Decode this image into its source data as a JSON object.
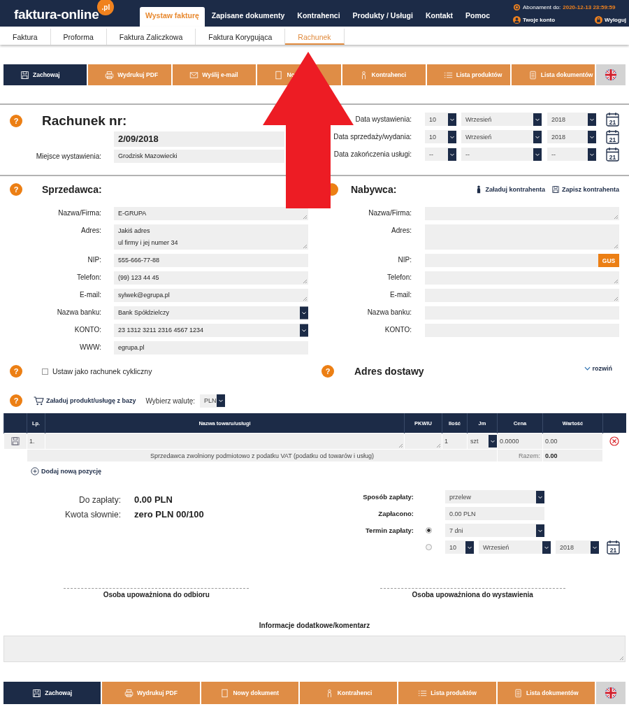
{
  "header": {
    "logo": "faktura-online",
    "logo_badge": ".pl",
    "nav": [
      {
        "label": "Wystaw fakturę",
        "selected": true
      },
      {
        "label": "Zapisane dokumenty",
        "selected": false
      },
      {
        "label": "Kontrahenci",
        "selected": false
      },
      {
        "label": "Produkty / Usługi",
        "selected": false
      },
      {
        "label": "Kontakt",
        "selected": false
      },
      {
        "label": "Pomoc",
        "selected": false
      }
    ],
    "subscription_label": "Abonament do:",
    "subscription_date": "2020-12-13 23:59:59",
    "account": "Twoje konto",
    "logout": "Wyloguj"
  },
  "doc_tabs": [
    {
      "label": "Faktura",
      "selected": false
    },
    {
      "label": "Proforma",
      "selected": false
    },
    {
      "label": "Faktura Zaliczkowa",
      "selected": false
    },
    {
      "label": "Faktura Korygująca",
      "selected": false
    },
    {
      "label": "Rachunek",
      "selected": true
    }
  ],
  "toolbar_top": [
    {
      "kind": "save",
      "label": "Zachowaj"
    },
    {
      "kind": "print",
      "label": "Wydrukuj PDF"
    },
    {
      "kind": "mail",
      "label": "Wyślij e-mail"
    },
    {
      "kind": "new",
      "label": "No"
    },
    {
      "kind": "contacts",
      "label": "Kontrahenci"
    },
    {
      "kind": "products",
      "label": "Lista produktów"
    },
    {
      "kind": "documents",
      "label": "Lista dokumentów"
    },
    {
      "kind": "language"
    }
  ],
  "invoice": {
    "help": "?",
    "title": "Rachunek nr:",
    "number": "2/09/2018",
    "place_label": "Miejsce wystawienia:",
    "place": "Grodzisk Mazowiecki"
  },
  "dates": [
    {
      "label": "Data wystawienia:",
      "day": "10",
      "month": "Wrzesień",
      "year": "2018",
      "calendar": "21"
    },
    {
      "label": "Data sprzedaży/wydania:",
      "day": "10",
      "month": "Wrzesień",
      "year": "2018",
      "calendar": "21"
    },
    {
      "label": "Data zakończenia usługi:",
      "day": "--",
      "month": "--",
      "year": "--",
      "calendar": "21"
    }
  ],
  "seller": {
    "help": "?",
    "title": "Sprzedawca:",
    "fields": [
      {
        "label": "Nazwa/Firma:",
        "kind": "textarea",
        "value": "E-GRUPA"
      },
      {
        "label": "Adres:",
        "kind": "address",
        "value": "Jakiś adres\nul firmy i jej numer 34"
      },
      {
        "label": "NIP:",
        "kind": "input",
        "value": "555-666-77-88"
      },
      {
        "label": "Telefon:",
        "kind": "textarea",
        "value": "(99) 123 44 45"
      },
      {
        "label": "E-mail:",
        "kind": "textarea",
        "value": "sylwek@egrupa.pl"
      },
      {
        "label": "Nazwa banku:",
        "kind": "select",
        "value": "Bank Spółdzielczy"
      },
      {
        "label": "KONTO:",
        "kind": "select",
        "value": "23 1312 3211 2316 4567 1234"
      },
      {
        "label": "WWW:",
        "kind": "input",
        "value": "egrupa.pl"
      }
    ]
  },
  "buyer": {
    "title": "Nabywca:",
    "load": "Załaduj kontrahenta",
    "save": "Zapisz kontrahenta",
    "fields": [
      {
        "label": "Nazwa/Firma:",
        "kind": "textarea"
      },
      {
        "label": "Adres:",
        "kind": "address"
      },
      {
        "label": "NIP:",
        "kind": "input",
        "button": "GUS"
      },
      {
        "label": "Telefon:",
        "kind": "textarea"
      },
      {
        "label": "E-mail:",
        "kind": "textarea"
      },
      {
        "label": "Nazwa banku:",
        "kind": "input"
      },
      {
        "label": "KONTO:",
        "kind": "input"
      }
    ]
  },
  "cyclic": {
    "help": "?",
    "label": "Ustaw jako rachunek cykliczny",
    "checked": false
  },
  "delivery": {
    "help": "?",
    "title": "Adres dostawy",
    "toggle": "rozwiń"
  },
  "products": {
    "help": "?",
    "load": "Załaduj produkt/usługę z bazy",
    "currency_label": "Wybierz walutę:",
    "currency": "PLN"
  },
  "table": {
    "columns": [
      "Lp.",
      "Nazwa towaru/usługi",
      "PKWIU",
      "Ilość",
      "Jm",
      "Cena",
      "Wartość"
    ],
    "rows": [
      {
        "lp": "1.",
        "qty": "1",
        "unit": "szt",
        "price": "0.0000",
        "value": "0.00"
      }
    ],
    "note": "Sprzedawca zwolniony podmiotowo z podatku VAT (podatku od towarów i usług)",
    "total_label": "Razem:",
    "total": "0.00"
  },
  "add_item": "Dodaj nową pozycję",
  "summary": {
    "due_label": "Do zapłaty:",
    "due": "0.00 PLN",
    "words_label": "Kwota słownie:",
    "words": "zero PLN 00/100"
  },
  "payment": {
    "method_label": "Sposób zapłaty:",
    "method": "przelew",
    "paid_label": "Zapłacono:",
    "paid": "0.00 PLN",
    "term_label": "Termin zapłaty:",
    "term_options": [
      {
        "kind": "preset",
        "value": "7 dni",
        "selected": true
      },
      {
        "kind": "date",
        "day": "10",
        "month": "Wrzesień",
        "year": "2018",
        "calendar": "21",
        "selected": false
      }
    ]
  },
  "signatures": [
    "Osoba upoważniona do odbioru",
    "Osoba upoważniona do wystawienia"
  ],
  "comments": {
    "label": "Informacje dodatkowe/komentarz"
  },
  "toolbar_bottom": [
    {
      "kind": "save",
      "label": "Zachowaj"
    },
    {
      "kind": "print",
      "label": "Wydrukuj PDF"
    },
    {
      "kind": "new",
      "label": "Nowy dokument"
    },
    {
      "kind": "contacts",
      "label": "Kontrahenci"
    },
    {
      "kind": "products",
      "label": "Lista produktów"
    },
    {
      "kind": "documents",
      "label": "Lista dokumentów"
    },
    {
      "kind": "language"
    }
  ]
}
